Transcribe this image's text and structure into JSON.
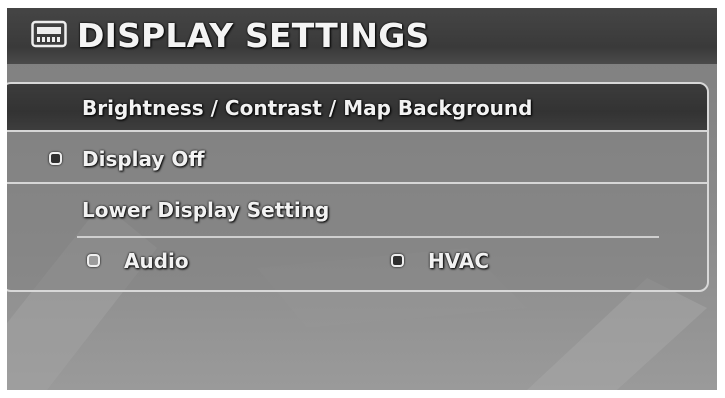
{
  "header": {
    "title": "DISPLAY SETTINGS",
    "icon": "display-settings-icon"
  },
  "menu": {
    "brightness_label": "Brightness / Contrast / Map Background",
    "display_off": {
      "label": "Display Off",
      "checked": false
    },
    "lower_display_label": "Lower Display Setting",
    "options": [
      {
        "label": "Audio",
        "selected": true
      },
      {
        "label": "HVAC",
        "selected": false
      }
    ]
  },
  "colors": {
    "title_bar": "#3a3a3a",
    "highlight_row": "#333333",
    "panel_border": "#d8d8d8",
    "text": "#f2f2f2"
  }
}
